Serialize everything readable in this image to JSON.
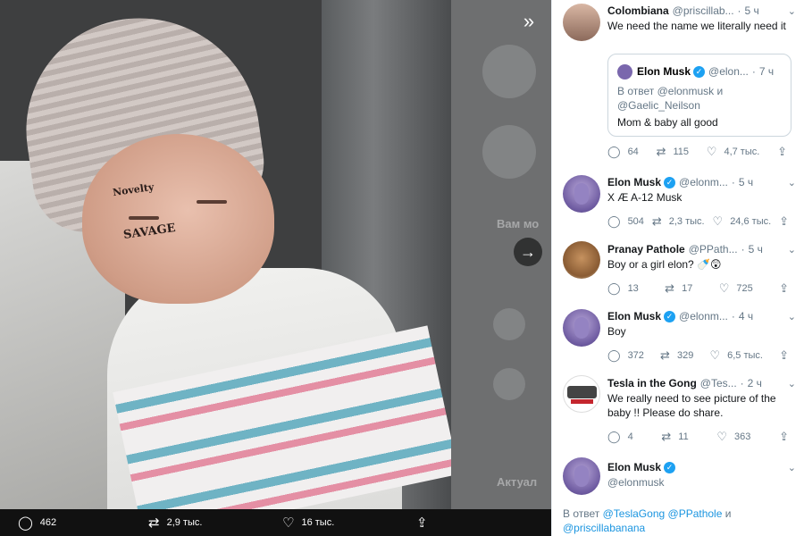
{
  "viewer": {
    "image_tattoo_savage": "SAVAGE",
    "image_tattoo_small": "Novelty",
    "background_text_1": "Вам мо",
    "background_text_2": "Актуал",
    "media_actions": {
      "replies": "462",
      "retweets": "2,9 тыс.",
      "likes": "16 тыс."
    }
  },
  "conversation": [
    {
      "name": "Colombiana",
      "handle": "@priscillab...",
      "time": "5 ч",
      "text": "We need the name we literally need it",
      "quote": {
        "name": "Elon Musk",
        "handle": "@elon...",
        "time": "7 ч",
        "reply_to": "В ответ @elonmusk и @Gaelic_Neilson",
        "text": "Mom & baby all good"
      },
      "actions": {
        "replies": "64",
        "retweets": "115",
        "likes": "4,7 тыс."
      }
    },
    {
      "name": "Elon Musk",
      "handle": "@elonm...",
      "time": "5 ч",
      "text": "X Æ A-12 Musk",
      "actions": {
        "replies": "504",
        "retweets": "2,3 тыс.",
        "likes": "24,6 тыс."
      }
    },
    {
      "name": "Pranay Pathole",
      "handle": "@PPath...",
      "time": "5 ч",
      "text": "Boy or a girl elon? 🍼😲",
      "actions": {
        "replies": "13",
        "retweets": "17",
        "likes": "725"
      }
    },
    {
      "name": "Elon Musk",
      "handle": "@elonm...",
      "time": "4 ч",
      "text": "Boy",
      "actions": {
        "replies": "372",
        "retweets": "329",
        "likes": "6,5 тыс."
      }
    },
    {
      "name": "Tesla in the Gong",
      "handle": "@Tes...",
      "time": "2 ч",
      "text": "We really need to see picture of the baby !! Please do share.",
      "actions": {
        "replies": "4",
        "retweets": "11",
        "likes": "363"
      }
    },
    {
      "name": "Elon Musk",
      "handle": "@elonmusk",
      "reply_prefix": "В ответ",
      "reply_link_1": "@TeslaGong",
      "reply_link_2": "@PPathole",
      "reply_and": "и",
      "reply_link_3": "@priscillabanana"
    }
  ],
  "icons": {
    "reply": "reply-icon",
    "retweet": "retweet-icon",
    "like": "heart-icon",
    "share": "share-icon",
    "verified": "verified-badge-icon"
  },
  "colors": {
    "link": "#1b95e0",
    "verified": "#1da1f2",
    "muted": "#657786"
  }
}
